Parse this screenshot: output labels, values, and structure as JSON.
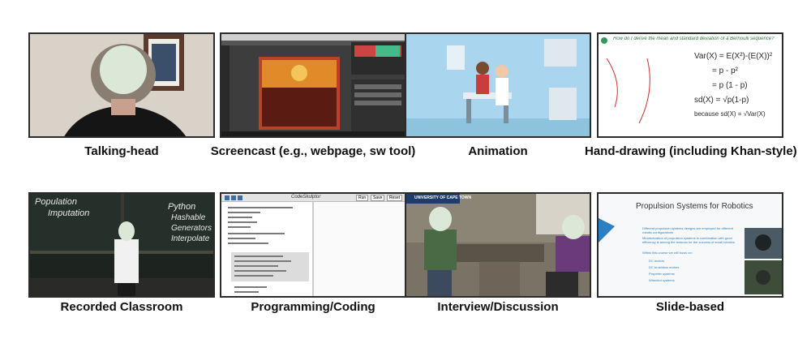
{
  "tiles": [
    {
      "caption": "Talking-head"
    },
    {
      "caption": "Screencast (e.g., webpage, sw tool)"
    },
    {
      "caption": "Animation"
    },
    {
      "caption": "Hand-drawing (including Khan-style)"
    },
    {
      "caption": "Recorded Classroom"
    },
    {
      "caption": "Programming/Coding"
    },
    {
      "caption": "Interview/Discussion"
    },
    {
      "caption": "Slide-based"
    }
  ],
  "board": {
    "left1": "Imputation",
    "left2": "Population",
    "right1": "Python",
    "right2": "Hashable",
    "right3": "Generators",
    "right4": "Interpolate"
  },
  "handwriting": {
    "title": "How do I derive the mean and standard deviation of a Bernoulli sequence?",
    "eq1": "Var(X) = E(X²)-(E(X))²",
    "eq2": "= p - p²",
    "eq3": "= p (1 - p)",
    "eq4": "sd(X) = √p(1-p)",
    "eq5": "because  sd(X) = √Var(X)"
  },
  "coding": {
    "title": "CodeSkulptor",
    "btn1": "Run",
    "btn2": "Save",
    "btn3": "Reset"
  },
  "interview": {
    "banner": "UNIVERSITY OF CAPE TOWN"
  },
  "slide": {
    "title": "Propulsion Systems for Robotics",
    "b1": "Different propulsion systems designs are employed for different robotic configurations",
    "b2": "Miniaturization of propulsion systems in combination with good efficiency is among the reasons for the success of small robotics",
    "b3": "Within this course we will focus on:",
    "s1": "DC motors",
    "s2": "DC brushless motors",
    "s3": "Propeller systems",
    "s4": "Wheeled systems"
  },
  "colors": {
    "border": "#2b2b2b",
    "face": "#dbe8d8",
    "anim_bg": "#a9d6ee",
    "board": "#1d2420",
    "ink_red": "#c8312b",
    "ink_green": "#2f7a3e"
  }
}
